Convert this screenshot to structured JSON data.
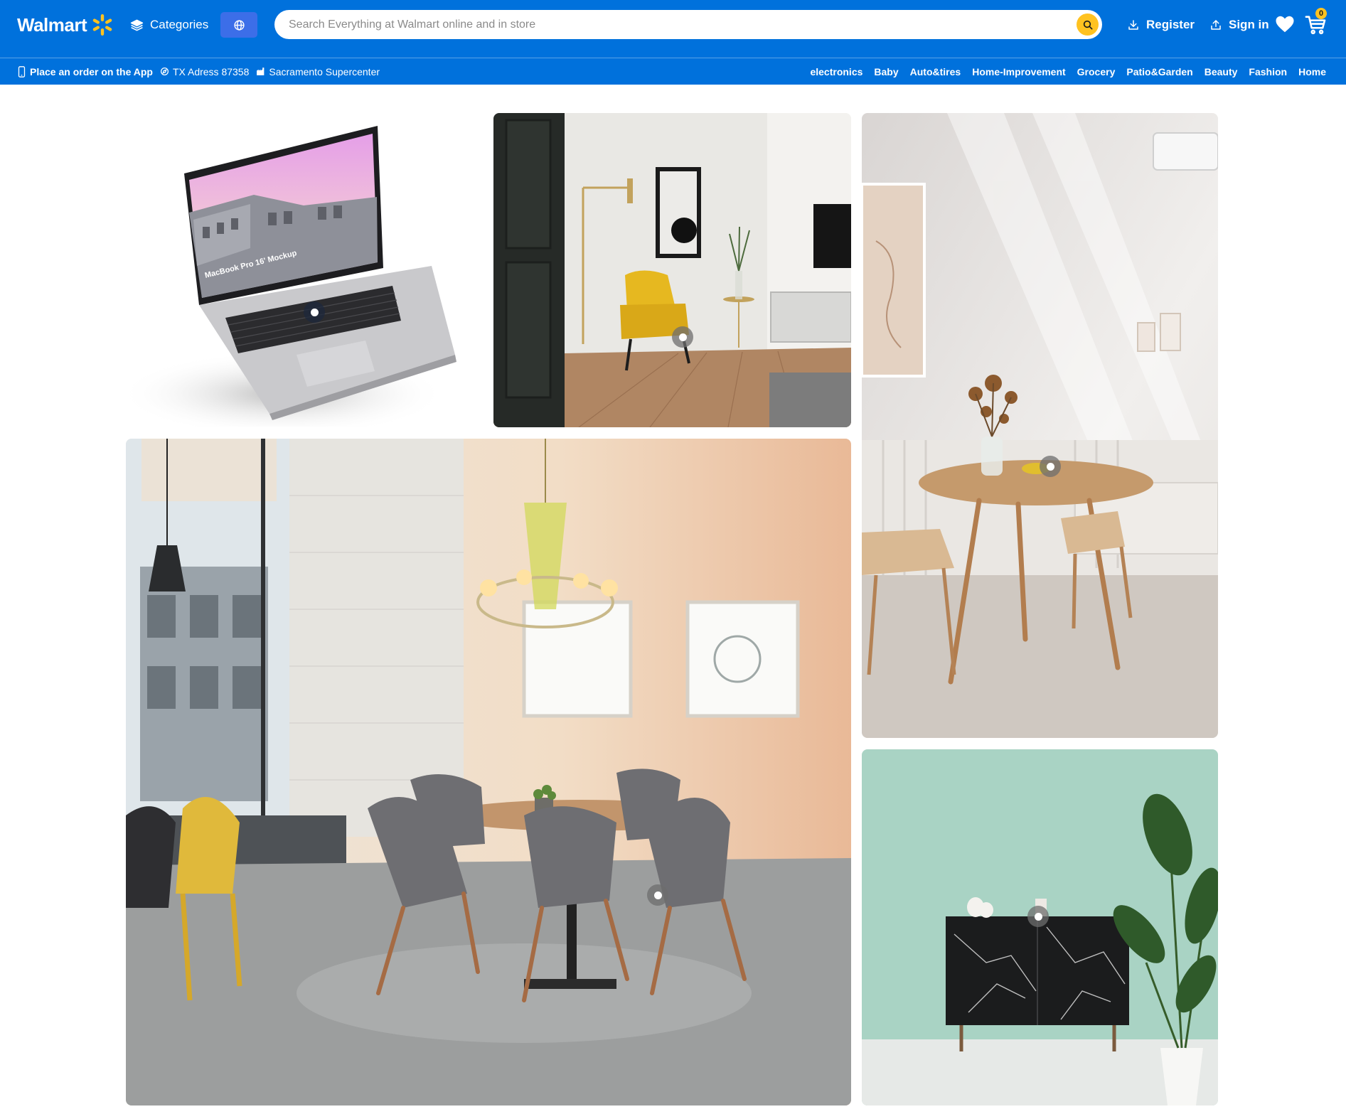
{
  "header": {
    "brand": "Walmart",
    "categories_label": "Categories",
    "search_placeholder": "Search Everything at Walmart online and in store",
    "register_label": "Register",
    "signin_label": "Sign in",
    "cart_count": "0"
  },
  "subbar": {
    "app_label": "Place an order on the App",
    "address_label": "TX Adress 87358",
    "store_label": "Sacramento Supercenter",
    "nav": [
      "electronics",
      "Baby",
      "Auto&tires",
      "Home-Improvement",
      "Grocery",
      "Patio&Garden",
      "Beauty",
      "Fashion",
      "Home"
    ]
  },
  "gallery": {
    "laptop_screen_text": "MacBook Pro 16' Mockup"
  },
  "colors": {
    "brand_blue": "#0071dc",
    "spark_yellow": "#ffc220"
  }
}
